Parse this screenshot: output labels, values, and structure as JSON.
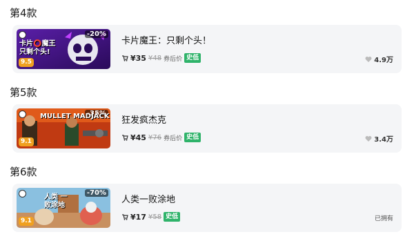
{
  "sections": [
    {
      "title": "第4款",
      "game": {
        "name": "卡片魔王：只剩个头！",
        "thumb_text": "卡片⭕魔王 只剩个头!",
        "discount": "-20%",
        "score": "9.5",
        "price": "¥35",
        "original_price": "¥48",
        "coupon_text": "券后价",
        "low_badge": "史低",
        "likes": "4.9万"
      }
    },
    {
      "title": "第5款",
      "game": {
        "name": "狂发疯杰克",
        "thumb_text": "MULLET MADJACK",
        "discount": "-35%",
        "score": "9.1",
        "price": "¥45",
        "original_price": "¥76",
        "coupon_text": "券后价",
        "low_badge": "史低",
        "likes": "3.4万"
      }
    },
    {
      "title": "第6款",
      "game": {
        "name": "人类一败涂地",
        "thumb_text": "人类 一败涂地",
        "discount": "-70%",
        "score": "9.1",
        "price": "¥17",
        "original_price": "¥58",
        "low_badge": "史低",
        "owned": "已拥有"
      }
    }
  ],
  "colors": {
    "card_bg": "#f4f5f7",
    "low_badge": "#2fb36a",
    "score_badge": "#f0a020"
  }
}
